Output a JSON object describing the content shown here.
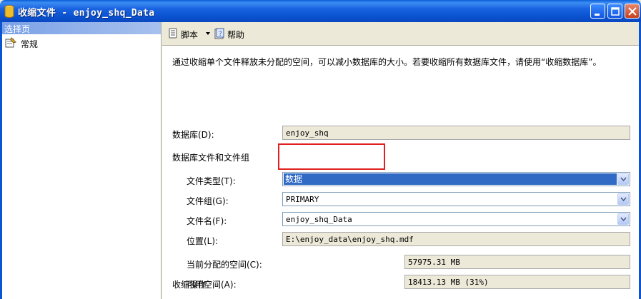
{
  "window": {
    "title_cn": "收缩文件",
    "title_sep": " - ",
    "title_file": "enjoy_shq_Data"
  },
  "leftpane": {
    "header": "选择页",
    "items": [
      {
        "label": "常规"
      }
    ]
  },
  "toolbar": {
    "script_label": "脚本",
    "help_label": "帮助"
  },
  "main": {
    "description": "通过收缩单个文件释放未分配的空间，可以减小数据库的大小。若要收缩所有数据库文件，请使用“收缩数据库”。",
    "database_label": "数据库(D):",
    "database_value": "enjoy_shq",
    "section_files": "数据库文件和文件组",
    "file_type_label": "文件类型(T):",
    "file_type_value": "数据",
    "filegroup_label": "文件组(G):",
    "filegroup_value": "PRIMARY",
    "filename_label": "文件名(F):",
    "filename_value": "enjoy_shq_Data",
    "location_label": "位置(L):",
    "location_value": "E:\\enjoy_data\\enjoy_shq.mdf",
    "allocated_label": "当前分配的空间(C):",
    "allocated_value": "57975.31 MB",
    "available_label": "可用空间(A):",
    "available_value": "18413.13 MB (31%)",
    "section_shrink": "收缩操作"
  },
  "colors": {
    "titlebar": "#0b54d2",
    "selection": "#316ac5",
    "highlight_box": "#e02020"
  }
}
